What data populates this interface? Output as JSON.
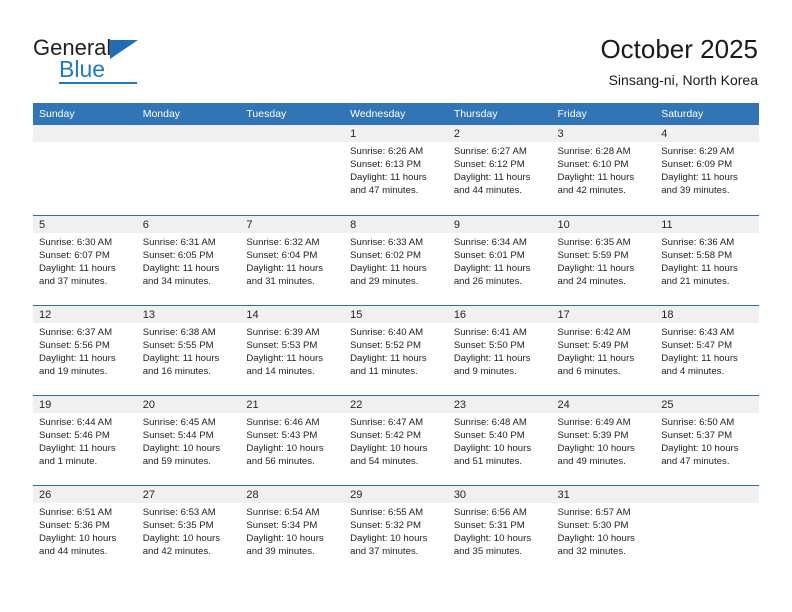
{
  "brand": {
    "name_top": "General",
    "name_bottom": "Blue",
    "accent_color": "#1f79c4",
    "header_color": "#3275b6"
  },
  "header": {
    "month_title": "October 2025",
    "location": "Sinsang-ni, North Korea"
  },
  "weekday_headers": [
    "Sunday",
    "Monday",
    "Tuesday",
    "Wednesday",
    "Thursday",
    "Friday",
    "Saturday"
  ],
  "labels": {
    "sunrise_prefix": "Sunrise:",
    "sunset_prefix": "Sunset:",
    "daylight_prefix": "Daylight:"
  },
  "weeks": [
    [
      {
        "day": "",
        "empty": true
      },
      {
        "day": "",
        "empty": true
      },
      {
        "day": "",
        "empty": true
      },
      {
        "day": "1",
        "sunrise": "Sunrise: 6:26 AM",
        "sunset": "Sunset: 6:13 PM",
        "daylight_line1": "Daylight: 11 hours",
        "daylight_line2": "and 47 minutes."
      },
      {
        "day": "2",
        "sunrise": "Sunrise: 6:27 AM",
        "sunset": "Sunset: 6:12 PM",
        "daylight_line1": "Daylight: 11 hours",
        "daylight_line2": "and 44 minutes."
      },
      {
        "day": "3",
        "sunrise": "Sunrise: 6:28 AM",
        "sunset": "Sunset: 6:10 PM",
        "daylight_line1": "Daylight: 11 hours",
        "daylight_line2": "and 42 minutes."
      },
      {
        "day": "4",
        "sunrise": "Sunrise: 6:29 AM",
        "sunset": "Sunset: 6:09 PM",
        "daylight_line1": "Daylight: 11 hours",
        "daylight_line2": "and 39 minutes."
      }
    ],
    [
      {
        "day": "5",
        "sunrise": "Sunrise: 6:30 AM",
        "sunset": "Sunset: 6:07 PM",
        "daylight_line1": "Daylight: 11 hours",
        "daylight_line2": "and 37 minutes."
      },
      {
        "day": "6",
        "sunrise": "Sunrise: 6:31 AM",
        "sunset": "Sunset: 6:05 PM",
        "daylight_line1": "Daylight: 11 hours",
        "daylight_line2": "and 34 minutes."
      },
      {
        "day": "7",
        "sunrise": "Sunrise: 6:32 AM",
        "sunset": "Sunset: 6:04 PM",
        "daylight_line1": "Daylight: 11 hours",
        "daylight_line2": "and 31 minutes."
      },
      {
        "day": "8",
        "sunrise": "Sunrise: 6:33 AM",
        "sunset": "Sunset: 6:02 PM",
        "daylight_line1": "Daylight: 11 hours",
        "daylight_line2": "and 29 minutes."
      },
      {
        "day": "9",
        "sunrise": "Sunrise: 6:34 AM",
        "sunset": "Sunset: 6:01 PM",
        "daylight_line1": "Daylight: 11 hours",
        "daylight_line2": "and 26 minutes."
      },
      {
        "day": "10",
        "sunrise": "Sunrise: 6:35 AM",
        "sunset": "Sunset: 5:59 PM",
        "daylight_line1": "Daylight: 11 hours",
        "daylight_line2": "and 24 minutes."
      },
      {
        "day": "11",
        "sunrise": "Sunrise: 6:36 AM",
        "sunset": "Sunset: 5:58 PM",
        "daylight_line1": "Daylight: 11 hours",
        "daylight_line2": "and 21 minutes."
      }
    ],
    [
      {
        "day": "12",
        "sunrise": "Sunrise: 6:37 AM",
        "sunset": "Sunset: 5:56 PM",
        "daylight_line1": "Daylight: 11 hours",
        "daylight_line2": "and 19 minutes."
      },
      {
        "day": "13",
        "sunrise": "Sunrise: 6:38 AM",
        "sunset": "Sunset: 5:55 PM",
        "daylight_line1": "Daylight: 11 hours",
        "daylight_line2": "and 16 minutes."
      },
      {
        "day": "14",
        "sunrise": "Sunrise: 6:39 AM",
        "sunset": "Sunset: 5:53 PM",
        "daylight_line1": "Daylight: 11 hours",
        "daylight_line2": "and 14 minutes."
      },
      {
        "day": "15",
        "sunrise": "Sunrise: 6:40 AM",
        "sunset": "Sunset: 5:52 PM",
        "daylight_line1": "Daylight: 11 hours",
        "daylight_line2": "and 11 minutes."
      },
      {
        "day": "16",
        "sunrise": "Sunrise: 6:41 AM",
        "sunset": "Sunset: 5:50 PM",
        "daylight_line1": "Daylight: 11 hours",
        "daylight_line2": "and 9 minutes."
      },
      {
        "day": "17",
        "sunrise": "Sunrise: 6:42 AM",
        "sunset": "Sunset: 5:49 PM",
        "daylight_line1": "Daylight: 11 hours",
        "daylight_line2": "and 6 minutes."
      },
      {
        "day": "18",
        "sunrise": "Sunrise: 6:43 AM",
        "sunset": "Sunset: 5:47 PM",
        "daylight_line1": "Daylight: 11 hours",
        "daylight_line2": "and 4 minutes."
      }
    ],
    [
      {
        "day": "19",
        "sunrise": "Sunrise: 6:44 AM",
        "sunset": "Sunset: 5:46 PM",
        "daylight_line1": "Daylight: 11 hours",
        "daylight_line2": "and 1 minute."
      },
      {
        "day": "20",
        "sunrise": "Sunrise: 6:45 AM",
        "sunset": "Sunset: 5:44 PM",
        "daylight_line1": "Daylight: 10 hours",
        "daylight_line2": "and 59 minutes."
      },
      {
        "day": "21",
        "sunrise": "Sunrise: 6:46 AM",
        "sunset": "Sunset: 5:43 PM",
        "daylight_line1": "Daylight: 10 hours",
        "daylight_line2": "and 56 minutes."
      },
      {
        "day": "22",
        "sunrise": "Sunrise: 6:47 AM",
        "sunset": "Sunset: 5:42 PM",
        "daylight_line1": "Daylight: 10 hours",
        "daylight_line2": "and 54 minutes."
      },
      {
        "day": "23",
        "sunrise": "Sunrise: 6:48 AM",
        "sunset": "Sunset: 5:40 PM",
        "daylight_line1": "Daylight: 10 hours",
        "daylight_line2": "and 51 minutes."
      },
      {
        "day": "24",
        "sunrise": "Sunrise: 6:49 AM",
        "sunset": "Sunset: 5:39 PM",
        "daylight_line1": "Daylight: 10 hours",
        "daylight_line2": "and 49 minutes."
      },
      {
        "day": "25",
        "sunrise": "Sunrise: 6:50 AM",
        "sunset": "Sunset: 5:37 PM",
        "daylight_line1": "Daylight: 10 hours",
        "daylight_line2": "and 47 minutes."
      }
    ],
    [
      {
        "day": "26",
        "sunrise": "Sunrise: 6:51 AM",
        "sunset": "Sunset: 5:36 PM",
        "daylight_line1": "Daylight: 10 hours",
        "daylight_line2": "and 44 minutes."
      },
      {
        "day": "27",
        "sunrise": "Sunrise: 6:53 AM",
        "sunset": "Sunset: 5:35 PM",
        "daylight_line1": "Daylight: 10 hours",
        "daylight_line2": "and 42 minutes."
      },
      {
        "day": "28",
        "sunrise": "Sunrise: 6:54 AM",
        "sunset": "Sunset: 5:34 PM",
        "daylight_line1": "Daylight: 10 hours",
        "daylight_line2": "and 39 minutes."
      },
      {
        "day": "29",
        "sunrise": "Sunrise: 6:55 AM",
        "sunset": "Sunset: 5:32 PM",
        "daylight_line1": "Daylight: 10 hours",
        "daylight_line2": "and 37 minutes."
      },
      {
        "day": "30",
        "sunrise": "Sunrise: 6:56 AM",
        "sunset": "Sunset: 5:31 PM",
        "daylight_line1": "Daylight: 10 hours",
        "daylight_line2": "and 35 minutes."
      },
      {
        "day": "31",
        "sunrise": "Sunrise: 6:57 AM",
        "sunset": "Sunset: 5:30 PM",
        "daylight_line1": "Daylight: 10 hours",
        "daylight_line2": "and 32 minutes."
      },
      {
        "day": "",
        "empty": true
      }
    ]
  ]
}
